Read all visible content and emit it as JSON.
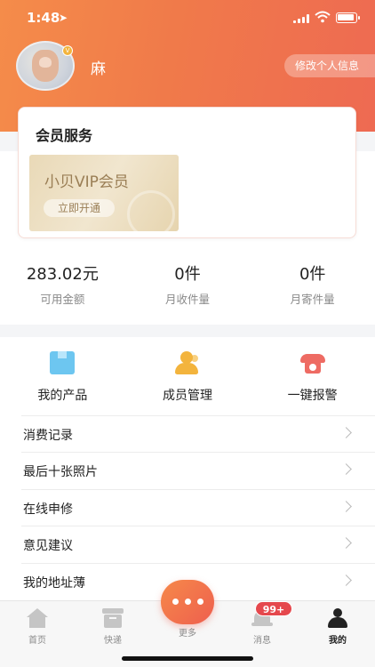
{
  "status_bar": {
    "time": "1:48"
  },
  "profile": {
    "name": "麻",
    "edit_button": "修改个人信息"
  },
  "vip_card": {
    "title": "会员服务",
    "banner_title": "小贝VIP会员",
    "banner_button": "立即开通"
  },
  "stats": [
    {
      "value": "283.02元",
      "label": "可用金额"
    },
    {
      "value": "0件",
      "label": "月收件量"
    },
    {
      "value": "0件",
      "label": "月寄件量"
    }
  ],
  "quick_actions": [
    {
      "label": "我的产品",
      "icon": "box-icon"
    },
    {
      "label": "成员管理",
      "icon": "members-icon"
    },
    {
      "label": "一键报警",
      "icon": "phone-icon"
    }
  ],
  "menu": [
    {
      "label": "消费记录"
    },
    {
      "label": "最后十张照片"
    },
    {
      "label": "在线申修"
    },
    {
      "label": "意见建议"
    },
    {
      "label": "我的地址薄"
    }
  ],
  "tabbar": {
    "home": "首页",
    "express": "快递",
    "more": "更多",
    "messages": "消息",
    "messages_badge": "99+",
    "mine": "我的"
  },
  "colors": {
    "accent": "#f07a4a",
    "badge": "#e5484d",
    "gold": "#9a7e55"
  }
}
